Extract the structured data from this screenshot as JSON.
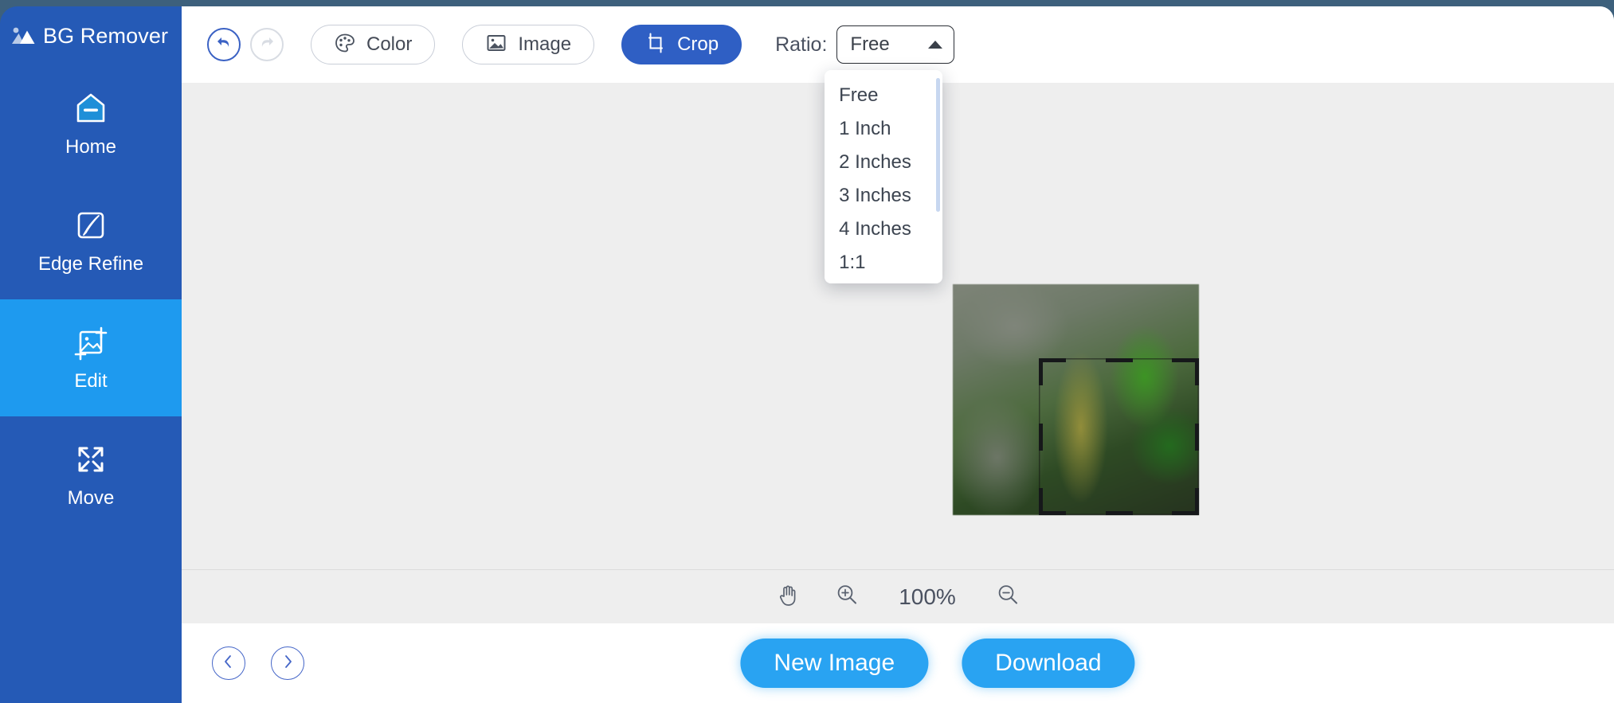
{
  "brand": {
    "name": "BG Remover",
    "logo_icon": "mountain-image-icon"
  },
  "sidebar": {
    "items": [
      {
        "label": "Home",
        "icon": "home-icon",
        "active": false
      },
      {
        "label": "Edge Refine",
        "icon": "edge-refine-icon",
        "active": false
      },
      {
        "label": "Edit",
        "icon": "edit-image-icon",
        "active": true
      },
      {
        "label": "Move",
        "icon": "move-icon",
        "active": false
      }
    ]
  },
  "toolbar": {
    "undo_icon": "undo-icon",
    "redo_icon": "redo-icon",
    "color_label": "Color",
    "color_icon": "palette-icon",
    "image_label": "Image",
    "image_icon": "picture-icon",
    "crop_label": "Crop",
    "crop_icon": "crop-icon",
    "ratio_label": "Ratio:",
    "ratio_value": "Free",
    "ratio_caret_icon": "caret-up-icon"
  },
  "ratio_dropdown": {
    "open": true,
    "options": [
      "Free",
      "1 Inch",
      "2 Inches",
      "3 Inches",
      "4 Inches",
      "1:1"
    ]
  },
  "zoom_bar": {
    "hand_icon": "hand-tool-icon",
    "zoom_in_icon": "zoom-in-icon",
    "zoom_out_icon": "zoom-out-icon",
    "zoom_level": "100%"
  },
  "action_bar": {
    "prev_icon": "chevron-left-icon",
    "next_icon": "chevron-right-icon",
    "new_image_label": "New Image",
    "download_label": "Download"
  },
  "colors": {
    "sidebar_blue": "#255ab6",
    "active_blue": "#1e9aef",
    "primary_button": "#2f5fc4",
    "cta_blue": "#29a3f2",
    "canvas_bg": "#eeeeee",
    "desktop_bg": "#43687f"
  }
}
